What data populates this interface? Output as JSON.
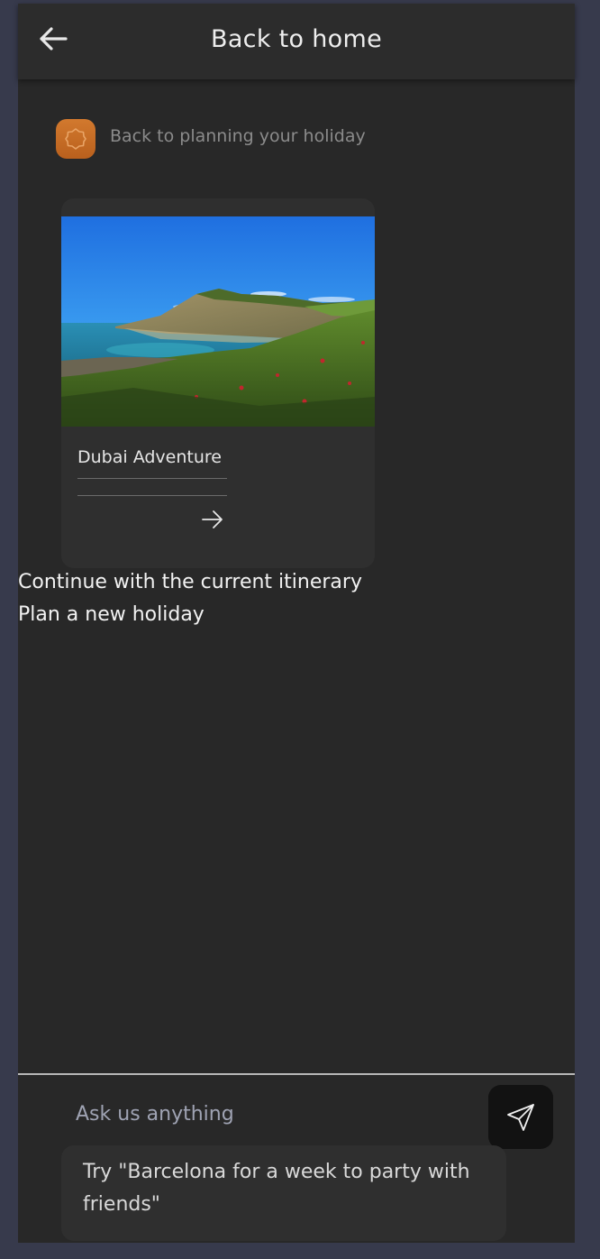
{
  "header": {
    "title": "Back to home",
    "back_icon": "arrow-left-icon"
  },
  "assistant": {
    "avatar_icon": "sun-logo-icon",
    "message": "Back to planning your holiday"
  },
  "trip_card": {
    "title": "Dubai Adventure",
    "image": "coastal-cliff-landscape",
    "arrow_icon": "arrow-right-icon"
  },
  "options": [
    {
      "label": "Continue with the current itinerary"
    },
    {
      "label": "Plan a new holiday"
    }
  ],
  "composer": {
    "placeholder": "Ask us anything",
    "value": "",
    "send_icon": "paper-plane-icon",
    "suggestion": "Try \"Barcelona for a week to party with friends\""
  },
  "colors": {
    "page_background": "#373a4c",
    "app_background": "#282828",
    "header_background": "#2c2c2c",
    "avatar_accent": "#c76b24",
    "send_button": "#121212"
  }
}
